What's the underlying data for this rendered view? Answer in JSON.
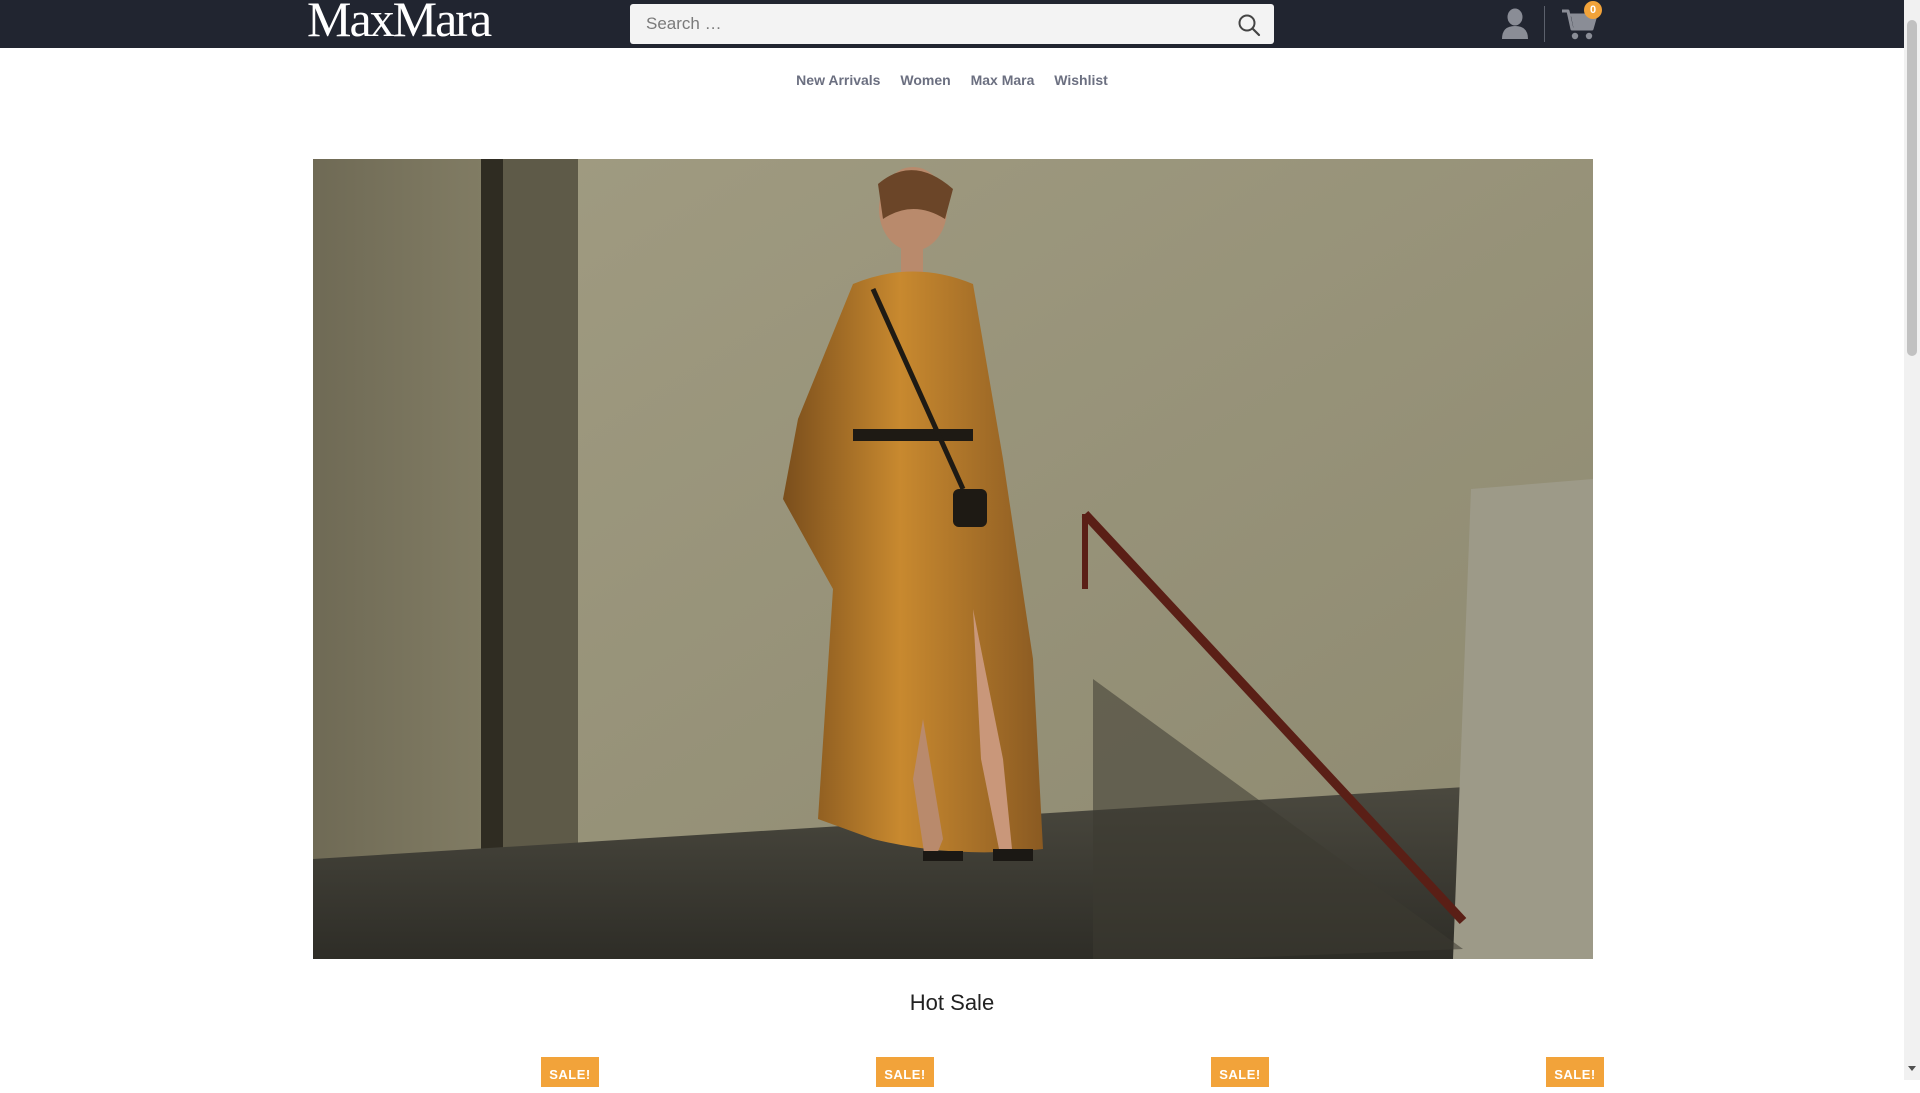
{
  "header": {
    "logo_text": "MaxMara",
    "search_placeholder": "Search …",
    "cart_count": "0",
    "accent_color": "#f2a33a",
    "bar_color": "#212530"
  },
  "nav": {
    "items": [
      {
        "label": "New Arrivals"
      },
      {
        "label": "Women"
      },
      {
        "label": "Max Mara"
      },
      {
        "label": "Wishlist"
      }
    ]
  },
  "main": {
    "section_title": "Hot Sale",
    "products": [
      {
        "badge": "SALE!"
      },
      {
        "badge": "SALE!"
      },
      {
        "badge": "SALE!"
      },
      {
        "badge": "SALE!"
      }
    ]
  },
  "icons": [
    "search-icon",
    "user-icon",
    "cart-icon"
  ]
}
